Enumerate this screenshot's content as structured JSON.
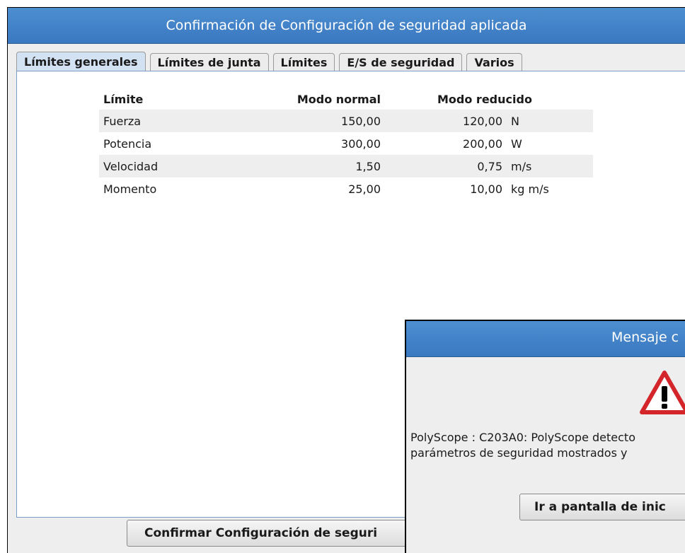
{
  "window": {
    "title": "Confirmación de Configuración de seguridad aplicada"
  },
  "tabs": [
    {
      "label": "Límites generales",
      "active": true
    },
    {
      "label": "Límites de junta",
      "active": false
    },
    {
      "label": "Límites",
      "active": false
    },
    {
      "label": "E/S de seguridad",
      "active": false
    },
    {
      "label": "Varios",
      "active": false
    }
  ],
  "table": {
    "headers": [
      "Límite",
      "Modo normal",
      "Modo reducido"
    ],
    "rows": [
      {
        "name": "Fuerza",
        "normal": "150,00",
        "reduced": "120,00",
        "unit": "N"
      },
      {
        "name": "Potencia",
        "normal": "300,00",
        "reduced": "200,00",
        "unit": "W"
      },
      {
        "name": "Velocidad",
        "normal": "1,50",
        "reduced": "0,75",
        "unit": "m/s"
      },
      {
        "name": "Momento",
        "normal": "25,00",
        "reduced": "10,00",
        "unit": "kg m/s"
      }
    ]
  },
  "confirm_button": "Confirmar Configuración de seguri",
  "dialog": {
    "title": "Mensaje c",
    "icon": "warning-icon",
    "message_line1": "PolyScope : C203A0: PolyScope detecto",
    "message_line2": "parámetros de seguridad mostrados y",
    "button": "Ir a pantalla de inic"
  },
  "colors": {
    "titlebar": "#3f82c8",
    "active_tab": "#d2e2f3",
    "warning_red": "#d4262a"
  }
}
